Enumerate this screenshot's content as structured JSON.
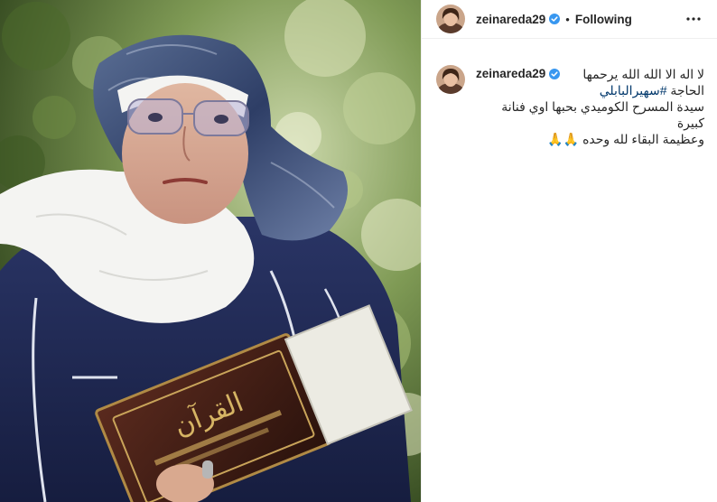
{
  "post": {
    "header": {
      "username": "zeinareda29",
      "separator": "•",
      "follow_status": "Following"
    },
    "caption": {
      "username": "zeinareda29",
      "line1": "لا اله الا الله الله يرحمها",
      "line2_prefix": "الحاجة",
      "hashtag": "#سهيرالبابلي",
      "line3": "سيدة المسرح الكوميدي بحبها اوي فنانة كبيرة",
      "line4": "وعظيمة البقاء لله وحده",
      "emoji": "🙏🙏"
    },
    "icons": {
      "verified": "verified-badge-icon",
      "more": "more-options-icon"
    },
    "colors": {
      "text": "#262626",
      "verified": "#3897f0",
      "hashtag": "#00376b",
      "divider": "#efefef"
    },
    "media": {
      "book_title": "القرآن"
    }
  }
}
